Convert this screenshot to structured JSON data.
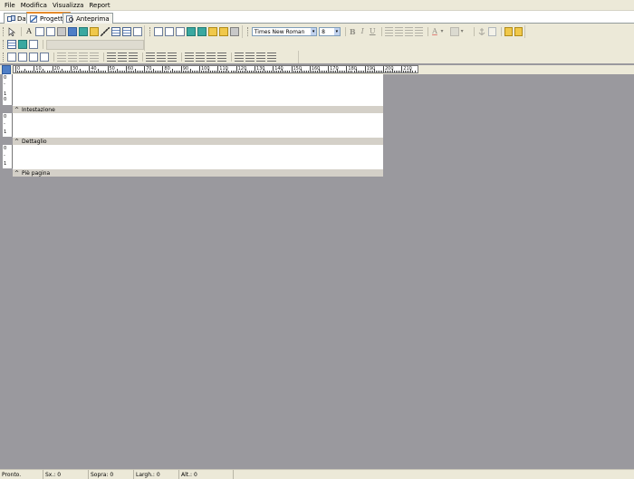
{
  "menu": [
    "File",
    "Modifica",
    "Visualizza",
    "Report"
  ],
  "tabs": [
    {
      "label": "Dati",
      "icon": "database-icon",
      "active": false
    },
    {
      "label": "Progetto",
      "icon": "design-icon",
      "active": true
    },
    {
      "label": "Anteprima",
      "icon": "preview-icon",
      "active": false
    }
  ],
  "format": {
    "font_family": "Times New Roman",
    "font_size": "8",
    "bold_label": "B",
    "italic_label": "I",
    "underline_label": "U",
    "text_label": "A"
  },
  "ruler": {
    "marks": [
      "0",
      "10",
      "20",
      "30",
      "40",
      "50",
      "60",
      "70",
      "80",
      "90",
      "100",
      "110",
      "120",
      "130",
      "140",
      "150",
      "160",
      "170",
      "180",
      "190",
      "200",
      "210"
    ]
  },
  "bands": [
    {
      "name": "Intestazione",
      "vmarks": [
        "0",
        "-",
        "1",
        "0"
      ]
    },
    {
      "name": "Dettaglio",
      "vmarks": [
        "0",
        "-",
        "1"
      ]
    },
    {
      "name": "Piè pagina",
      "vmarks": [
        "0",
        "-",
        "1"
      ]
    }
  ],
  "status": {
    "ready": "Pronto.",
    "sx": "Sx.: 0",
    "sopra": "Sopra: 0",
    "largh": "Largh.: 0",
    "alt": "Alt.: 0"
  },
  "colors": {
    "workspace": "#9a999e",
    "chrome": "#ece9d8",
    "band_header": "#d4d0c8",
    "active_tab_accent": "#e68b2c"
  }
}
